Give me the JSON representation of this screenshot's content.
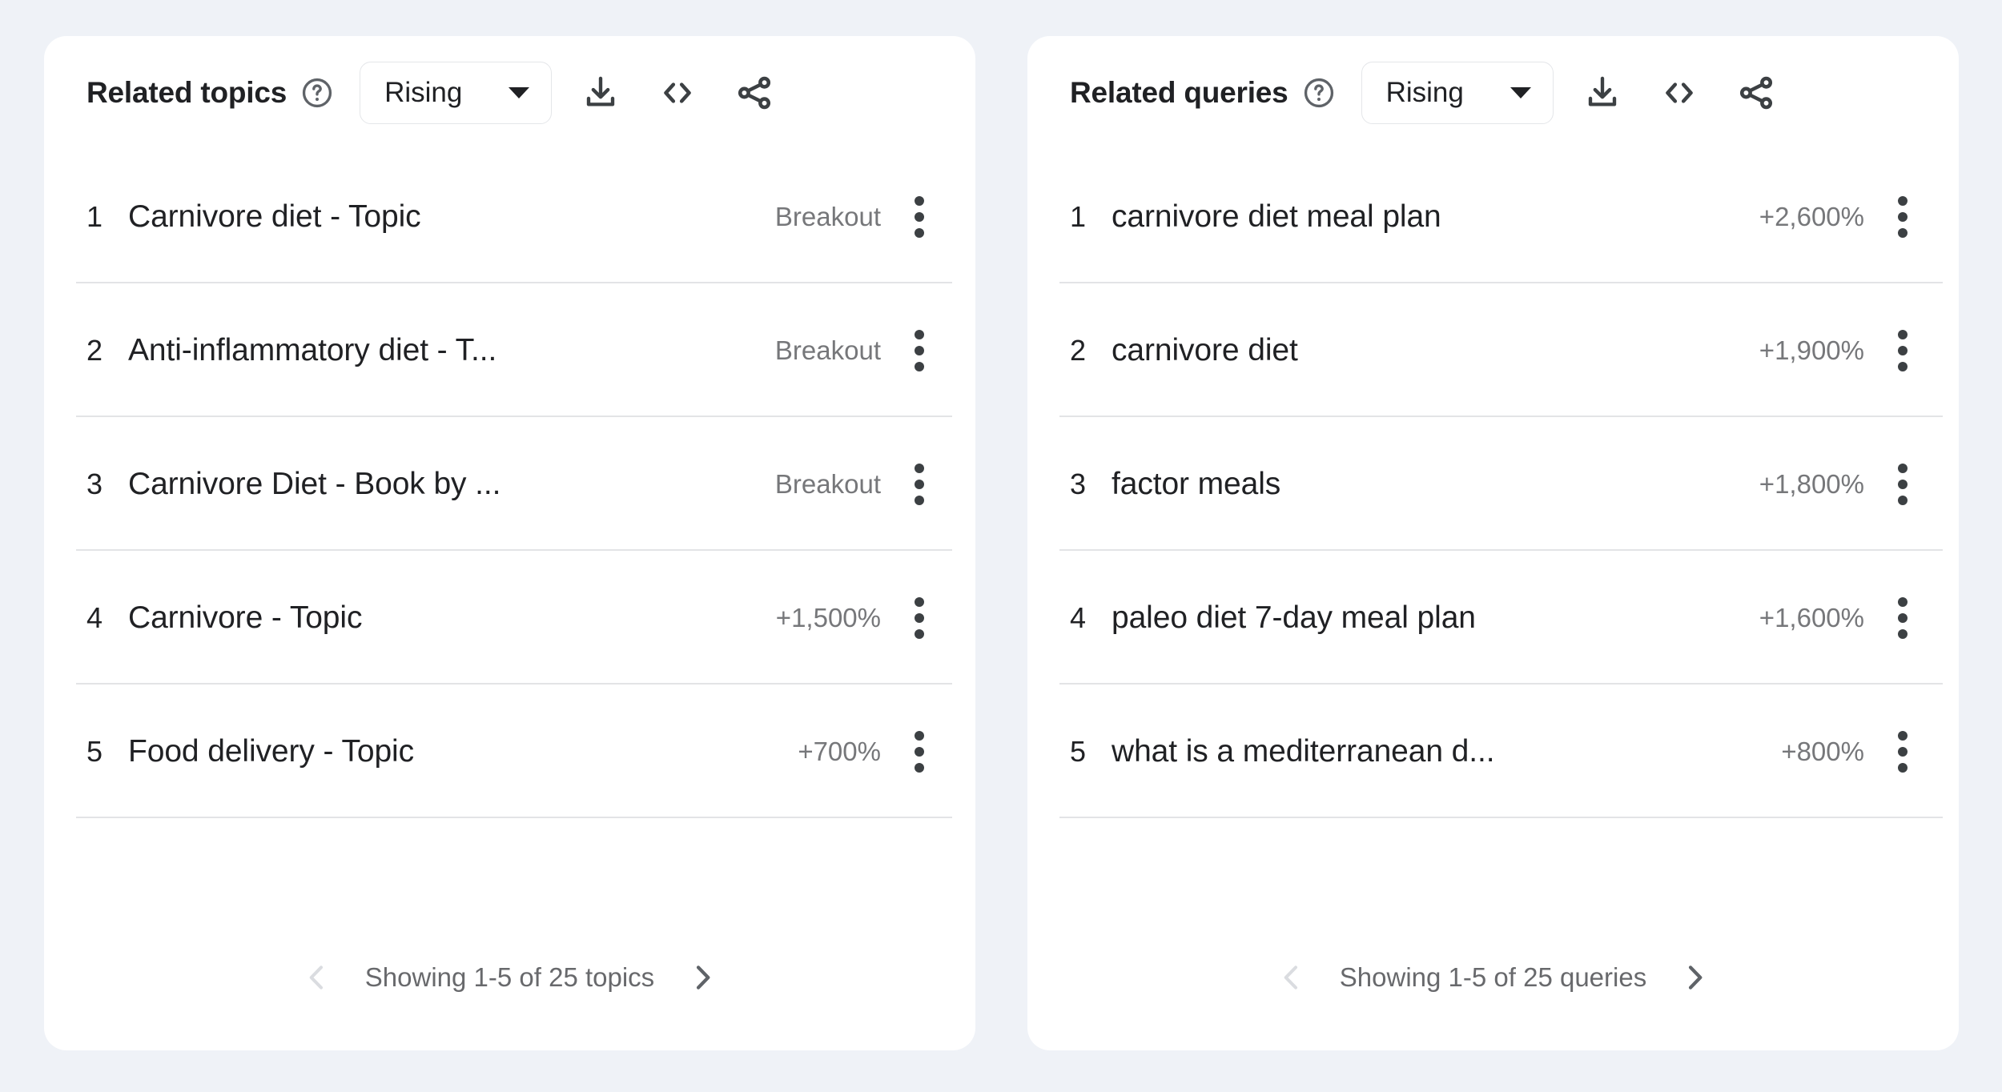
{
  "theme": {
    "page_background": "#eff2f7",
    "card_background": "#ffffff",
    "text_primary": "#202124",
    "text_secondary": "#76777a",
    "divider": "#e3e4e6",
    "icon": "#3c4043",
    "pager_disabled": "#dadce0",
    "pager_enabled": "#5f6368"
  },
  "panels": [
    {
      "id": "related-topics",
      "title": "Related topics",
      "help_icon": "help-circle-icon",
      "sort": {
        "value": "Rising",
        "icon": "chevron-down-icon"
      },
      "actions": [
        {
          "name": "download-icon",
          "label": "Download"
        },
        {
          "name": "embed-code-icon",
          "label": "Embed"
        },
        {
          "name": "share-icon",
          "label": "Share"
        }
      ],
      "rows": [
        {
          "rank": "1",
          "label": "Carnivore diet - Topic",
          "value": "Breakout",
          "menu": "more-options-icon"
        },
        {
          "rank": "2",
          "label": "Anti-inflammatory diet - T...",
          "value": "Breakout",
          "menu": "more-options-icon"
        },
        {
          "rank": "3",
          "label": "Carnivore Diet - Book by ...",
          "value": "Breakout",
          "menu": "more-options-icon"
        },
        {
          "rank": "4",
          "label": "Carnivore - Topic",
          "value": "+1,500%",
          "menu": "more-options-icon"
        },
        {
          "rank": "5",
          "label": "Food delivery - Topic",
          "value": "+700%",
          "menu": "more-options-icon"
        }
      ],
      "footer": {
        "prev_icon": "chevron-left-icon",
        "prev_enabled": false,
        "text": "Showing 1-5 of 25 topics",
        "next_icon": "chevron-right-icon",
        "next_enabled": true
      }
    },
    {
      "id": "related-queries",
      "title": "Related queries",
      "help_icon": "help-circle-icon",
      "sort": {
        "value": "Rising",
        "icon": "chevron-down-icon"
      },
      "actions": [
        {
          "name": "download-icon",
          "label": "Download"
        },
        {
          "name": "embed-code-icon",
          "label": "Embed"
        },
        {
          "name": "share-icon",
          "label": "Share"
        }
      ],
      "rows": [
        {
          "rank": "1",
          "label": "carnivore diet meal plan",
          "value": "+2,600%",
          "menu": "more-options-icon"
        },
        {
          "rank": "2",
          "label": "carnivore diet",
          "value": "+1,900%",
          "menu": "more-options-icon"
        },
        {
          "rank": "3",
          "label": "factor meals",
          "value": "+1,800%",
          "menu": "more-options-icon"
        },
        {
          "rank": "4",
          "label": "paleo diet 7-day meal plan",
          "value": "+1,600%",
          "menu": "more-options-icon"
        },
        {
          "rank": "5",
          "label": "what is a mediterranean d...",
          "value": "+800%",
          "menu": "more-options-icon"
        }
      ],
      "footer": {
        "prev_icon": "chevron-left-icon",
        "prev_enabled": false,
        "text": "Showing 1-5 of 25 queries",
        "next_icon": "chevron-right-icon",
        "next_enabled": true
      }
    }
  ]
}
